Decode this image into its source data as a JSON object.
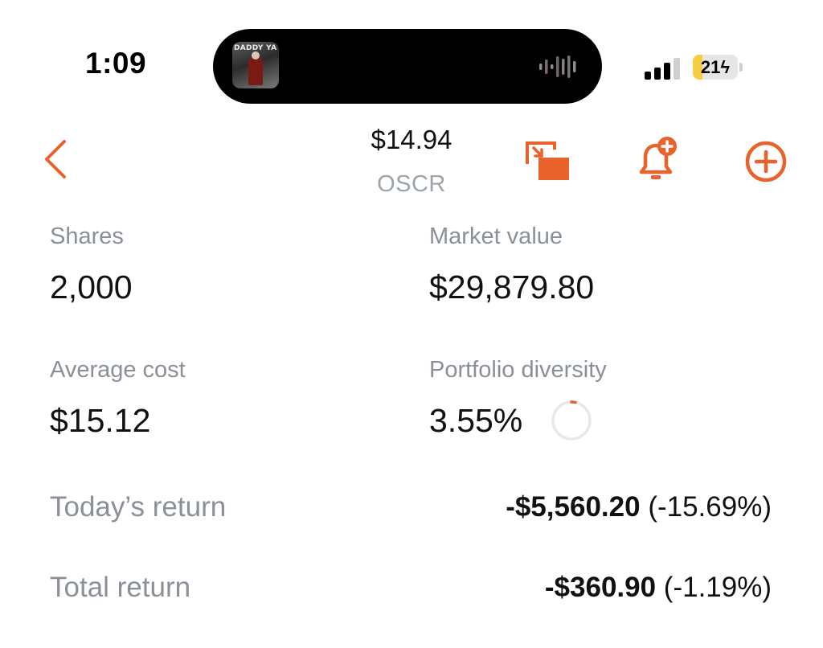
{
  "status_bar": {
    "time": "1:09",
    "album_art_text": "DADDY YANKEE",
    "battery_level": "21",
    "battery_fraction": 0.21,
    "icons": [
      "album-art",
      "audio-waveform-icon",
      "cellular-signal-icon",
      "battery-icon",
      "charging-bolt-icon"
    ]
  },
  "header": {
    "price": "$14.94",
    "ticker": "OSCR",
    "accent_color": "#e8622c",
    "icons": [
      "back-chevron-icon",
      "picture-in-picture-icon",
      "add-alert-bell-icon",
      "add-circle-icon"
    ]
  },
  "stats": {
    "shares_label": "Shares",
    "shares_value": "2,000",
    "market_value_label": "Market value",
    "market_value_value": "$29,879.80",
    "average_cost_label": "Average cost",
    "average_cost_value": "$15.12",
    "diversity_label": "Portfolio diversity",
    "diversity_value": "3.55%",
    "diversity_fraction": 0.0355
  },
  "returns": {
    "today_label": "Today’s return",
    "today_amount": "-$5,560.20",
    "today_percent": " (-15.69%)",
    "total_label": "Total return",
    "total_amount": "-$360.90",
    "total_percent": " (-1.19%)"
  }
}
